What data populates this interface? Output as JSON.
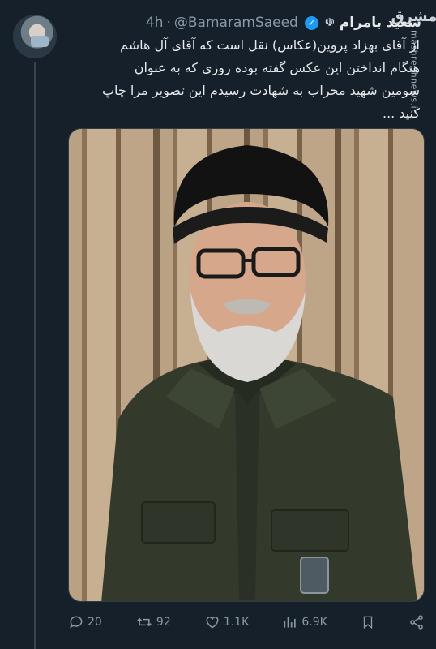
{
  "tweet": {
    "display_name": "سعید بامرام",
    "handle": "@BamaramSaeed",
    "time": "4h",
    "separator": "·",
    "text_lines": [
      "از آقای بهزاد پروین(عکاس) نقل است که  آقای آل هاشم",
      "هنگام انداختن این عکس گفته بوده روزی که به عنوان",
      "سومین شهید محراب به شهادت رسیدم این تصویر مرا چاپ",
      "کنید ..."
    ]
  },
  "watermark": {
    "logo": "مشرق",
    "site": "mashreghnews.ir"
  },
  "actions": {
    "replies": "20",
    "retweets": "92",
    "likes": "1.1K",
    "views": "6.9K"
  },
  "icons": [
    "emblem-icon",
    "verified-icon",
    "reply-icon",
    "retweet-icon",
    "like-icon",
    "views-icon",
    "bookmark-icon",
    "share-icon"
  ],
  "colors": {
    "background": "#15202b",
    "text": "#e7e9ea",
    "muted": "#8b98a5",
    "verified": "#1d9bf0"
  }
}
